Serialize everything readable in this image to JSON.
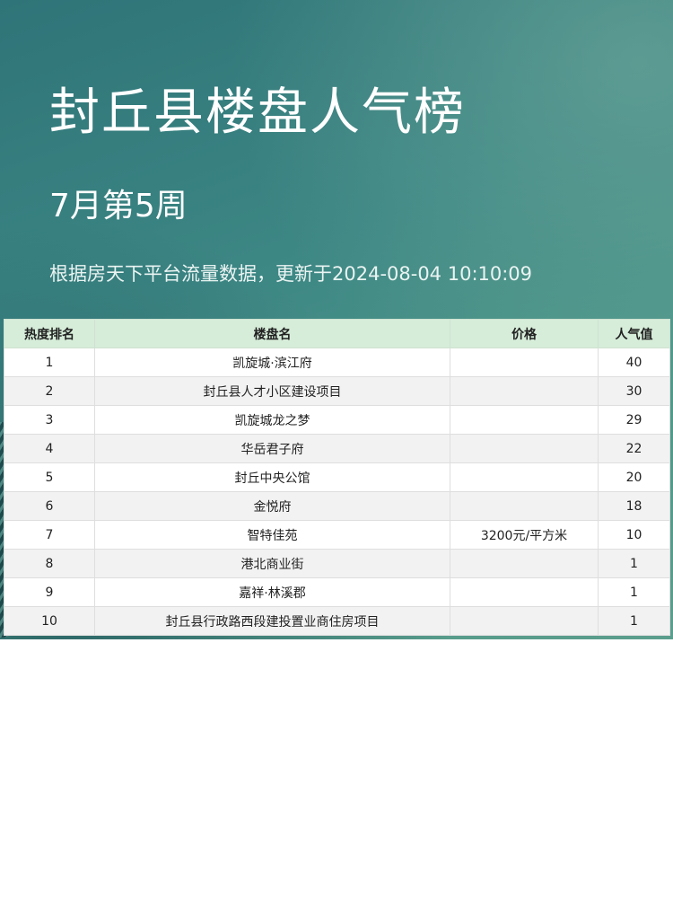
{
  "header": {
    "title": "封丘县楼盘人气榜",
    "subtitle": "7月第5周",
    "note": "根据房天下平台流量数据，更新于2024-08-04 10:10:09"
  },
  "table": {
    "columns": [
      "热度排名",
      "楼盘名",
      "价格",
      "人气值"
    ],
    "rows": [
      {
        "rank": "1",
        "name": "凯旋城·滨江府",
        "price": "",
        "popularity": "40"
      },
      {
        "rank": "2",
        "name": "封丘县人才小区建设项目",
        "price": "",
        "popularity": "30"
      },
      {
        "rank": "3",
        "name": "凯旋城龙之梦",
        "price": "",
        "popularity": "29"
      },
      {
        "rank": "4",
        "name": "华岳君子府",
        "price": "",
        "popularity": "22"
      },
      {
        "rank": "5",
        "name": "封丘中央公馆",
        "price": "",
        "popularity": "20"
      },
      {
        "rank": "6",
        "name": "金悦府",
        "price": "",
        "popularity": "18"
      },
      {
        "rank": "7",
        "name": "智特佳苑",
        "price": "3200元/平方米",
        "popularity": "10"
      },
      {
        "rank": "8",
        "name": "港北商业街",
        "price": "",
        "popularity": "1"
      },
      {
        "rank": "9",
        "name": "嘉祥·林溪郡",
        "price": "",
        "popularity": "1"
      },
      {
        "rank": "10",
        "name": "封丘县行政路西段建投置业商住房项目",
        "price": "",
        "popularity": "1"
      }
    ]
  },
  "colors": {
    "header_gradient_start": "#2f7478",
    "header_gradient_end": "#5c9e8d",
    "table_header_bg": "#d6edd9",
    "row_alt_bg": "#f2f2f2"
  }
}
